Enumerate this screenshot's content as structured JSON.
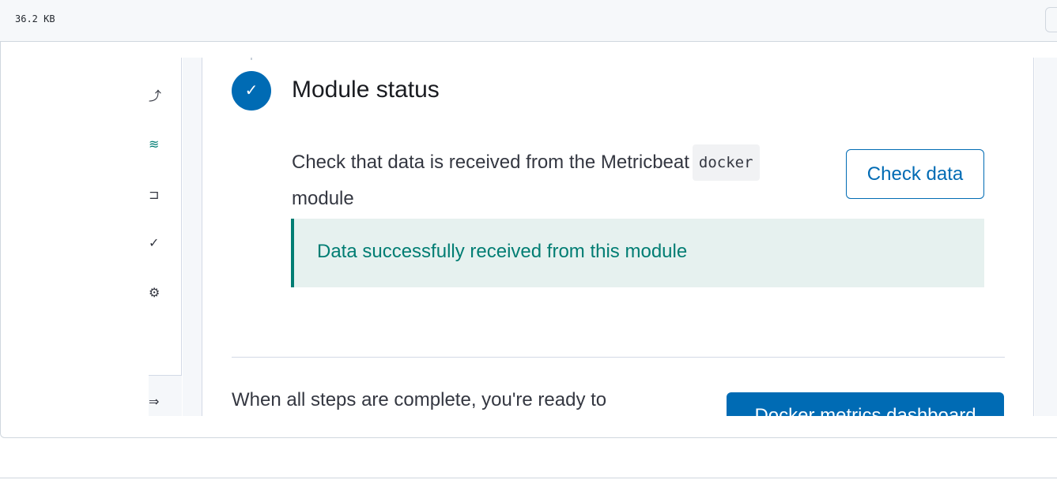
{
  "file_header": {
    "size_label": "36.2 KB"
  },
  "side_nav": {
    "items": [
      {
        "icon": "upload-arrow-icon"
      },
      {
        "icon": "feed-icon"
      },
      {
        "icon": "plug-icon"
      },
      {
        "icon": "heartbeat-check-icon"
      },
      {
        "icon": "gear-icon"
      }
    ],
    "collapse_icon": "collapse-arrow-icon"
  },
  "module_status": {
    "title": "Module status",
    "description_before": "Check that data is received from the Metricbeat",
    "module_code": "docker",
    "description_after": "module",
    "check_button_label": "Check data",
    "success_message": "Data successfully received from this module"
  },
  "footer": {
    "complete_text": "When all steps are complete, you're ready to",
    "dashboard_button_label": "Docker metrics dashboard"
  },
  "colors": {
    "primary": "#006bb4",
    "success": "#017d73",
    "success_bg": "#e6f1ef"
  }
}
